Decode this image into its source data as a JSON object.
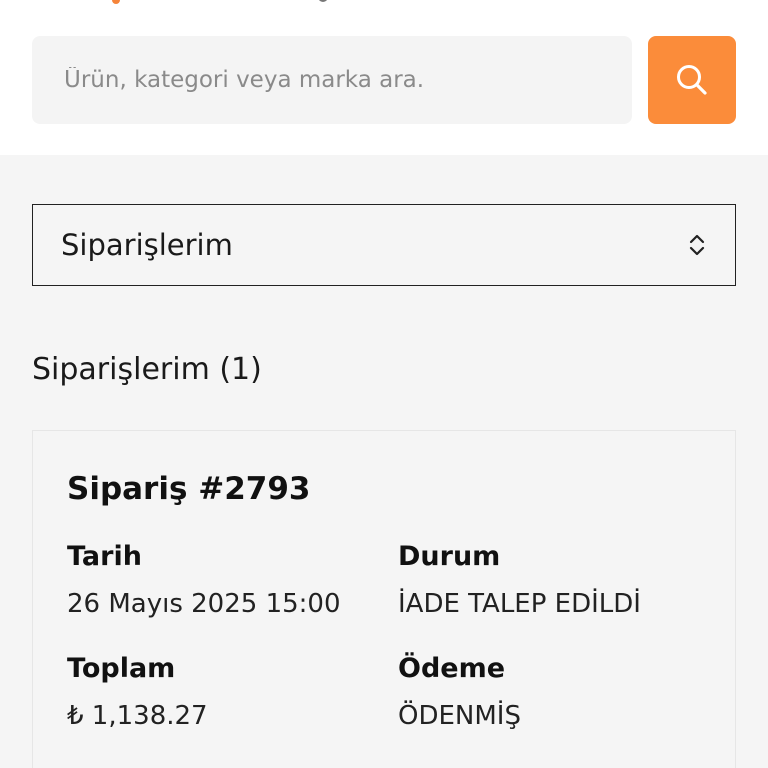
{
  "search": {
    "placeholder": "Ürün, kategori veya marka ara.",
    "button_icon": "search-icon"
  },
  "colors": {
    "accent": "#fb8c3a",
    "background": "#f5f5f5",
    "header_background": "#ffffff"
  },
  "orders_select": {
    "selected": "Siparişlerim",
    "icon": "chevron-up-down-icon"
  },
  "orders_section": {
    "title": "Siparişlerim (1)"
  },
  "order": {
    "title": "Sipariş #2793",
    "date_label": "Tarih",
    "date_value": "26 Mayıs 2025 15:00",
    "status_label": "Durum",
    "status_value": "İADE TALEP EDİLDİ",
    "total_label": "Toplam",
    "total_value": "₺ 1,138.27",
    "payment_label": "Ödeme",
    "payment_value": "ÖDENMİŞ"
  }
}
